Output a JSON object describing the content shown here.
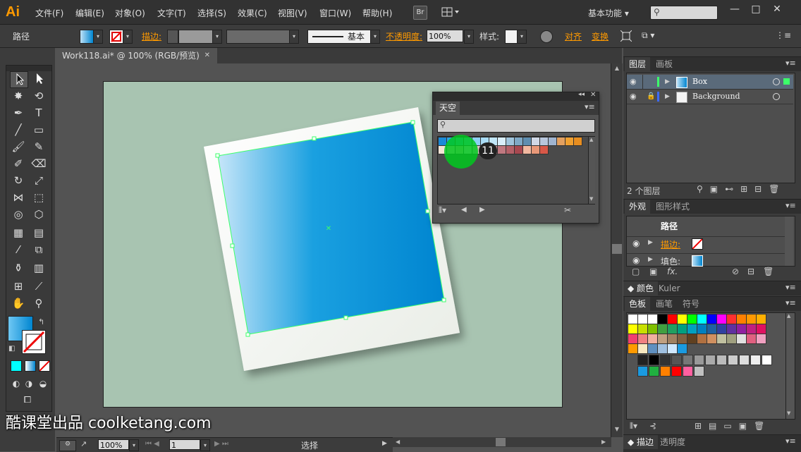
{
  "app": {
    "logo": "Ai"
  },
  "menu": [
    "文件(F)",
    "编辑(E)",
    "对象(O)",
    "文字(T)",
    "选择(S)",
    "效果(C)",
    "视图(V)",
    "窗口(W)",
    "帮助(H)"
  ],
  "toolbar": {
    "bridge_label": "Br",
    "workspace": "基本功能",
    "window_controls": [
      "—",
      "□",
      "✕"
    ]
  },
  "control_bar": {
    "selection_type": "路径",
    "stroke_label": "描边:",
    "stroke_style": "基本",
    "opacity_label": "不透明度:",
    "opacity_value": "100%",
    "style_label": "样式:",
    "align_label": "对齐",
    "transform_label": "变换"
  },
  "document": {
    "tab_title": "Work118.ai* @ 100% (RGB/预览)",
    "tab_close": "✕"
  },
  "status_bar": {
    "zoom": "100%",
    "artboard": "1",
    "tool": "选择"
  },
  "swatch_library_panel": {
    "tab": "天空",
    "click_marker": "11"
  },
  "layers_panel": {
    "tabs": [
      "图层",
      "画板"
    ],
    "layers": [
      {
        "name": "Box"
      },
      {
        "name": "Background"
      }
    ],
    "count": "2 个图层"
  },
  "appearance_panel": {
    "tabs": [
      "外观",
      "图形样式"
    ],
    "header": "路径",
    "rows": [
      {
        "label": "描边:"
      },
      {
        "label": "填色:"
      }
    ],
    "fx": "fx."
  },
  "color_panel": {
    "tabs": [
      "颜色",
      "Kuler"
    ]
  },
  "swatches_panel": {
    "tabs": [
      "色板",
      "画笔",
      "符号"
    ]
  },
  "bottom_panel": {
    "tabs": [
      "描边",
      "透明度"
    ]
  },
  "watermark": "酷课堂出品 coolketang.com",
  "colors": {
    "accent": "#ff9a00",
    "selection": "#3cff6a",
    "artboard_bg": "#a8c4b1",
    "gradient_start": "#bfe2f7",
    "gradient_end": "#0085d0",
    "click_marker": "#00c81e"
  }
}
